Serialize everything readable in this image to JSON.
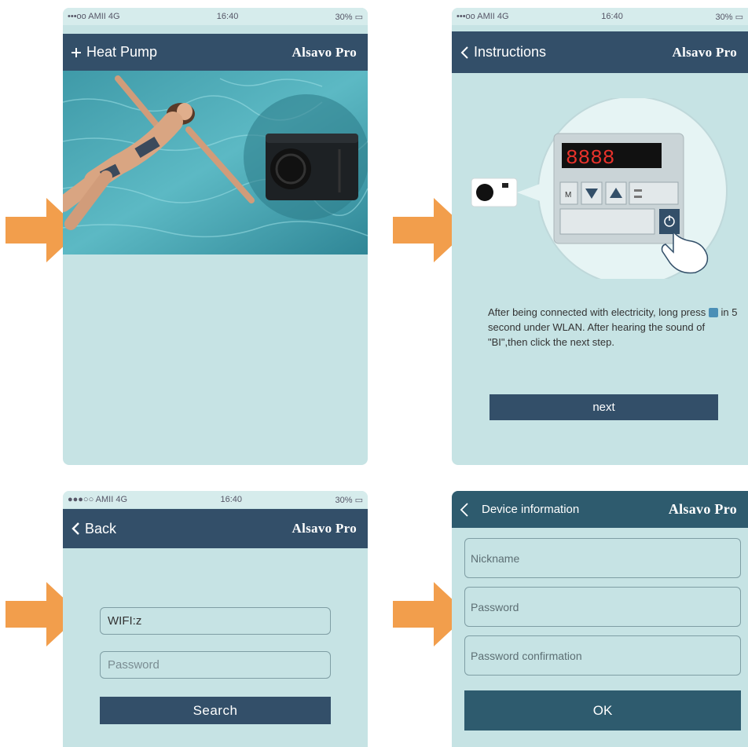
{
  "colors": {
    "accent_arrow": "#f29e4c",
    "navbar": "#334f69",
    "screen_bg": "#c6e3e4"
  },
  "screen1": {
    "status": {
      "carrier": "•••oo AMII 4G",
      "time": "16:40",
      "battery": "30%"
    },
    "nav": {
      "title": "Heat Pump",
      "brand": "Alsavo Pro",
      "icon": "plus-icon"
    }
  },
  "screen2": {
    "status": {
      "carrier": "•••oo AMII 4G",
      "time": "16:40",
      "battery": "30%"
    },
    "nav": {
      "title": "Instructions",
      "brand": "Alsavo Pro",
      "icon": "chevron-left-icon"
    },
    "display": "8888",
    "panel_m": "M",
    "instruction_pre": "After being connected with electricity, long press ",
    "instruction_post": " in 5 second under WLAN. After hearing the sound of \"BI\",then click the next step.",
    "next_label": "next"
  },
  "screen3": {
    "status": {
      "carrier": "●●●○○ AMII 4G",
      "time": "16:40",
      "battery": "30%"
    },
    "nav": {
      "title": "Back",
      "brand": "Alsavo Pro",
      "icon": "chevron-left-icon"
    },
    "wifi_value": "WIFI:z",
    "password_placeholder": "Password",
    "search_label": "Search"
  },
  "screen4": {
    "nav": {
      "title": "Device information",
      "brand": "Alsavo Pro",
      "icon": "chevron-left-icon"
    },
    "nickname_placeholder": "Nickname",
    "password_placeholder": "Password",
    "confirm_placeholder": "Password confirmation",
    "ok_label": "OK"
  }
}
